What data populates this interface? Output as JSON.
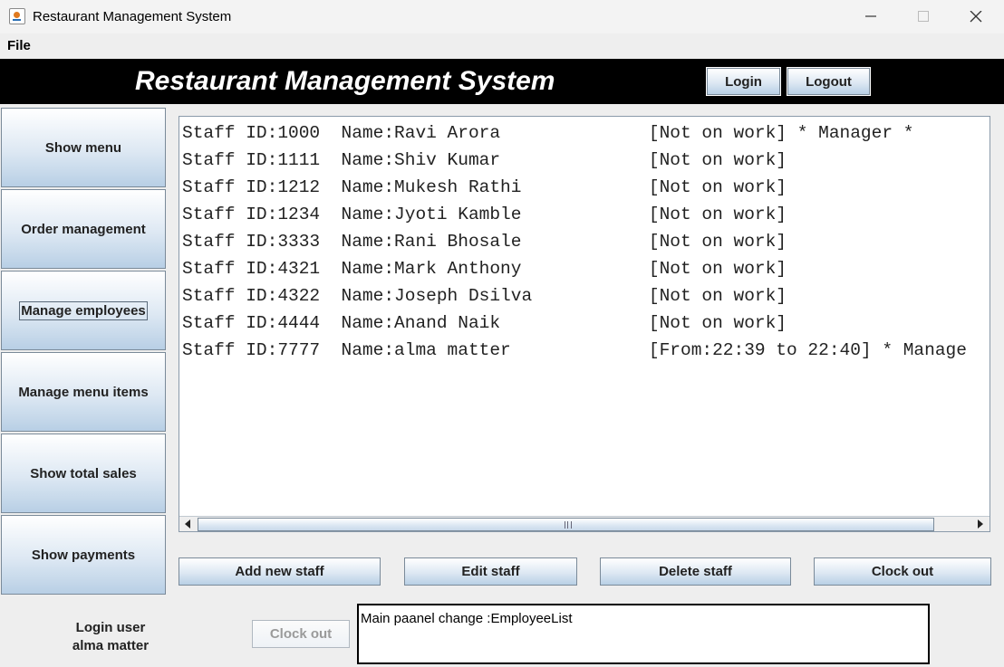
{
  "window": {
    "title": "Restaurant Management System"
  },
  "menubar": {
    "file": "File"
  },
  "header": {
    "title": "Restaurant Management System",
    "login": "Login",
    "logout": "Logout"
  },
  "sidebar": {
    "items": [
      {
        "label": "Show menu"
      },
      {
        "label": "Order management"
      },
      {
        "label": "Manage employees"
      },
      {
        "label": "Manage menu items"
      },
      {
        "label": "Show total sales"
      },
      {
        "label": "Show payments"
      }
    ]
  },
  "staff_list": {
    "rows": [
      "Staff ID:1000  Name:Ravi Arora              [Not on work] * Manager *",
      "Staff ID:1111  Name:Shiv Kumar              [Not on work]",
      "Staff ID:1212  Name:Mukesh Rathi            [Not on work]",
      "Staff ID:1234  Name:Jyoti Kamble            [Not on work]",
      "Staff ID:3333  Name:Rani Bhosale            [Not on work]",
      "Staff ID:4321  Name:Mark Anthony            [Not on work]",
      "Staff ID:4322  Name:Joseph Dsilva           [Not on work]",
      "Staff ID:4444  Name:Anand Naik              [Not on work]",
      "Staff ID:7777  Name:alma matter             [From:22:39 to 22:40] * Manage"
    ]
  },
  "actions": {
    "add": "Add new staff",
    "edit": "Edit staff",
    "delete": "Delete staff",
    "clockout": "Clock out"
  },
  "footer": {
    "login_user_label": "Login user",
    "login_user_name": "alma matter",
    "clockout_disabled": "Clock out",
    "status": "Main paanel change :EmployeeList"
  },
  "icons": {
    "app": "java-app-icon",
    "minimize": "minimize-icon",
    "maximize": "maximize-icon",
    "close": "close-icon",
    "scroll_left": "arrow-left-icon",
    "scroll_right": "arrow-right-icon"
  },
  "colors": {
    "banner": "#000000",
    "button_top": "#ffffff",
    "button_bottom": "#b8cfe5"
  }
}
